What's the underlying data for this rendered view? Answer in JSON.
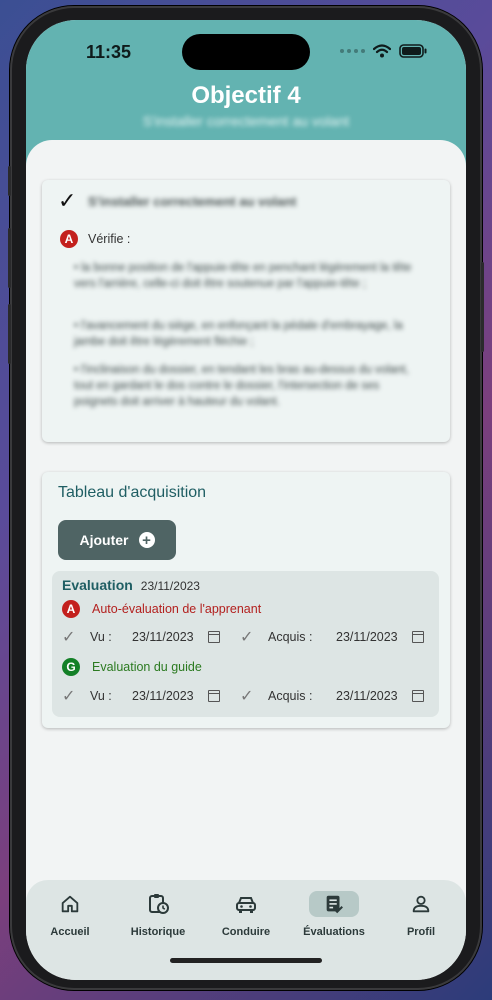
{
  "status": {
    "time": "11:35"
  },
  "header": {
    "title": "Objectif 4",
    "subtitle": "S'installer correctement au volant"
  },
  "objective_card": {
    "heading": "S'installer correctement au volant",
    "badge": "A",
    "verifie_label": "Vérifie :",
    "items": [
      "• la bonne position de l'appuie-tête en penchant légèrement la tête vers l'arrière, celle-ci doit être soutenue par l'appuie-tête ;",
      "• l'avancement du siège, en enfonçant la pédale d'embrayage, la jambe doit être légèrement fléchie ;",
      "• l'inclinaison du dossier, en tendant les bras au-dessus du volant, tout en gardant le dos contre le dossier, l'intersection de ses poignets doit arriver à hauteur du volant."
    ]
  },
  "acquisition": {
    "title": "Tableau d'acquisition",
    "add_button": "Ajouter",
    "evaluation": {
      "title": "Evaluation",
      "date": "23/11/2023",
      "self": {
        "badge": "A",
        "label": "Auto-évaluation de l'apprenant",
        "vu_label": "Vu :",
        "vu_date": "23/11/2023",
        "acquis_label": "Acquis :",
        "acquis_date": "23/11/2023"
      },
      "guide": {
        "badge": "G",
        "label": "Evaluation du guide",
        "vu_label": "Vu :",
        "vu_date": "23/11/2023",
        "acquis_label": "Acquis :",
        "acquis_date": "23/11/2023"
      }
    }
  },
  "nav": {
    "items": [
      {
        "label": "Accueil",
        "icon": "home-icon"
      },
      {
        "label": "Historique",
        "icon": "history-icon"
      },
      {
        "label": "Conduire",
        "icon": "car-icon"
      },
      {
        "label": "Évaluations",
        "icon": "evaluations-icon",
        "active": true
      },
      {
        "label": "Profil",
        "icon": "profile-icon"
      }
    ]
  },
  "colors": {
    "header": "#63b3b1",
    "accent": "#1f5e63",
    "button": "#4f6464",
    "red_badge": "#c3201d",
    "green_badge": "#138027"
  }
}
